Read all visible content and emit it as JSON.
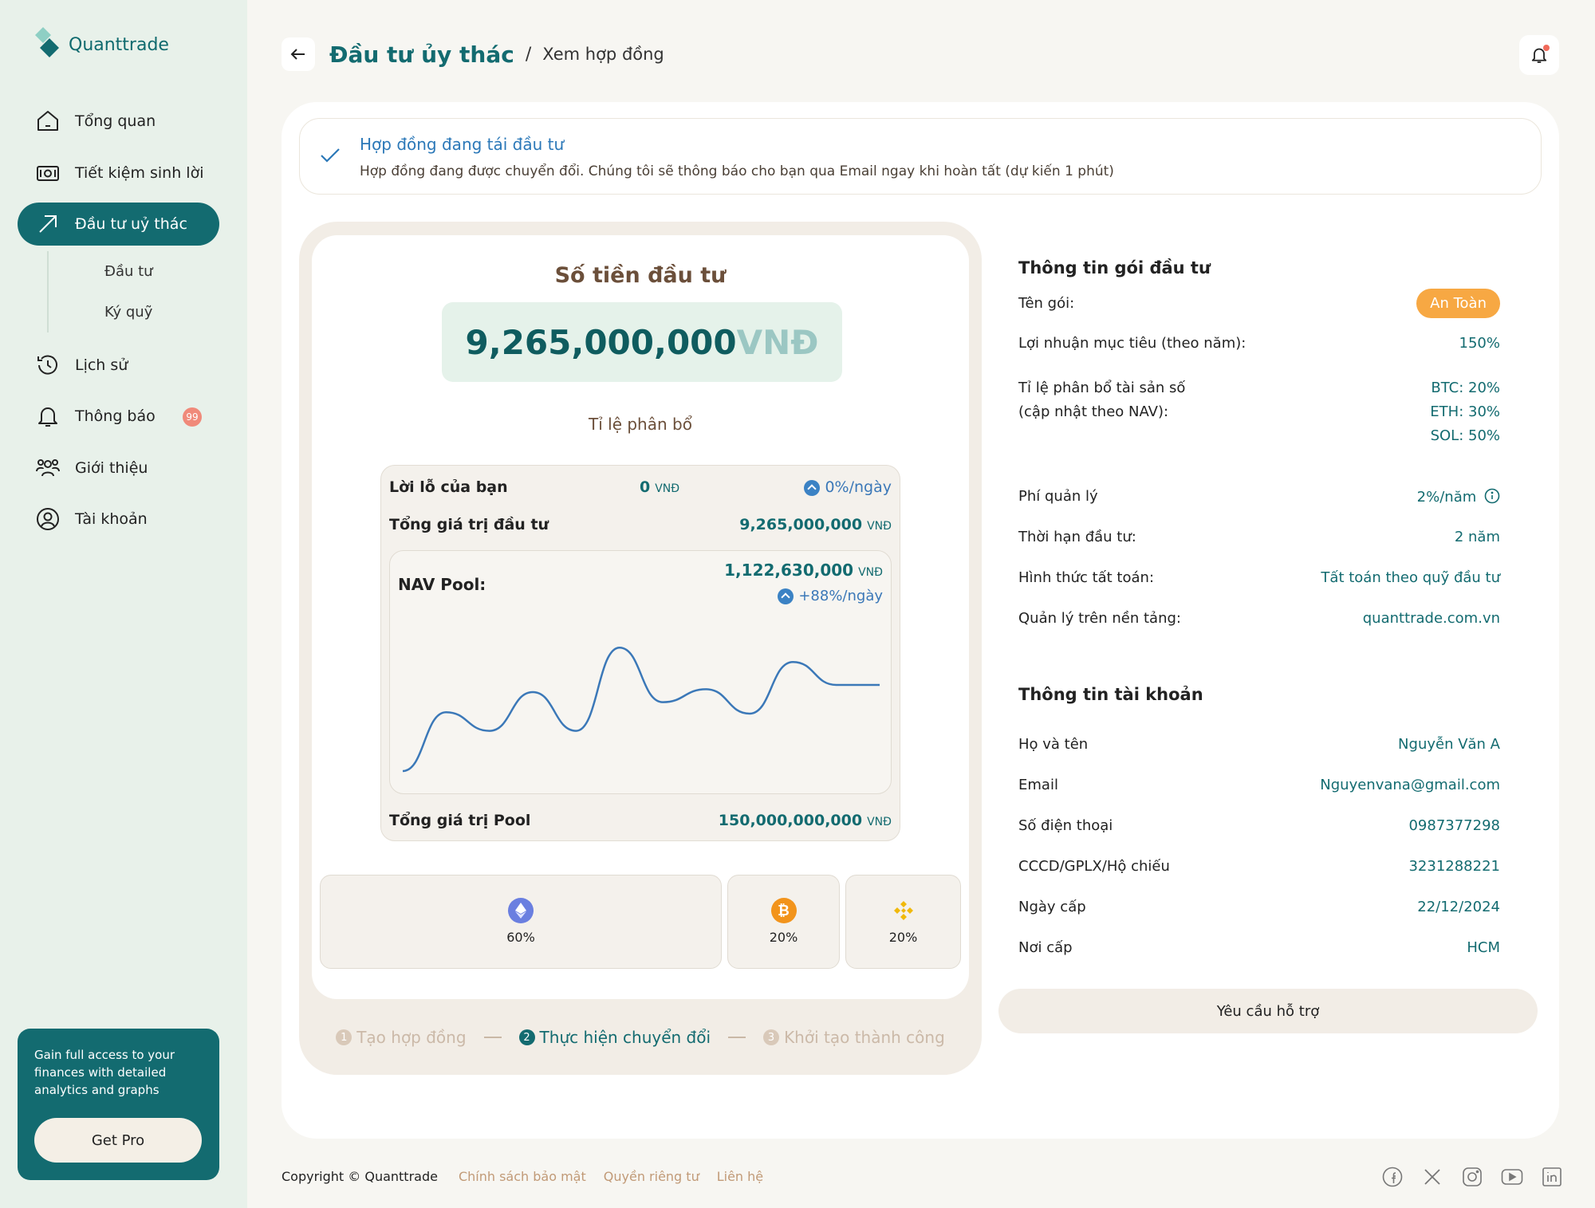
{
  "app": {
    "name": "Quanttrade"
  },
  "sidebar": {
    "items": [
      {
        "label": "Tổng quan"
      },
      {
        "label": "Tiết kiệm sinh lời"
      },
      {
        "label": "Đầu tư uỷ thác"
      },
      {
        "label": "Lịch sử"
      },
      {
        "label": "Thông báo",
        "badge": "99"
      },
      {
        "label": "Giới thiệu"
      },
      {
        "label": "Tài khoản"
      }
    ],
    "subitems": [
      {
        "label": "Đầu tư"
      },
      {
        "label": "Ký quỹ"
      }
    ],
    "promo": {
      "text": "Gain full access to your finances with detailed analytics and graphs",
      "button": "Get Pro"
    }
  },
  "header": {
    "title": "Đầu tư ủy thác",
    "separator": "/",
    "breadcrumb": "Xem hợp đồng"
  },
  "alert": {
    "title": "Hợp đồng đang tái đầu tư",
    "message": "Hợp đồng đang được chuyển đổi. Chúng tôi sẽ thông báo cho bạn qua Email ngay khi hoàn tất (dự kiến 1 phút)"
  },
  "investment": {
    "title": "Số tiền đầu tư",
    "amount": "9,265,000,000",
    "unit": "VNĐ",
    "allocation_label": "Tỉ lệ phân bổ",
    "pnl_label": "Lời lỗ của bạn",
    "pnl_value": "0",
    "pnl_unit": "VNĐ",
    "pnl_rate": "0%/ngày",
    "total_label": "Tổng giá trị đầu tư",
    "total_value": "9,265,000,000",
    "total_unit": "VNĐ",
    "nav_label": "NAV Pool:",
    "nav_value": "1,122,630,000",
    "nav_unit": "VNĐ",
    "nav_rate": "+88%/ngày",
    "pool_label": "Tổng giá trị Pool",
    "pool_value": "150,000,000,000",
    "pool_unit": "VNĐ",
    "coins": [
      {
        "icon": "ethereum-icon",
        "pct": "60%",
        "color": "#6a7fe0"
      },
      {
        "icon": "bitcoin-icon",
        "pct": "20%",
        "color": "#f2941c"
      },
      {
        "icon": "binance-icon",
        "pct": "20%",
        "color": "#f0b90b"
      }
    ]
  },
  "chart_data": {
    "type": "line",
    "series": [
      {
        "values": [
          5,
          46,
          33,
          60,
          33,
          91,
          53,
          62,
          45,
          81,
          65,
          65
        ]
      }
    ],
    "ylim": [
      0,
      100
    ],
    "color": "#3b78b8"
  },
  "stepper": [
    {
      "num": "1",
      "label": "Tạo hợp đồng"
    },
    {
      "num": "2",
      "label": "Thực hiện chuyển đổi"
    },
    {
      "num": "3",
      "label": "Khởi tạo thành công"
    }
  ],
  "package": {
    "title": "Thông tin gói đầu tư",
    "name_label": "Tên gói:",
    "name_value": "An Toàn",
    "profit_label": "Lợi nhuận mục tiêu (theo năm):",
    "profit_value": "150%",
    "alloc_label_1": "Tỉ lệ phân bổ tài sản số",
    "alloc_label_2": "(cập nhật theo NAV):",
    "alloc_btc": "BTC: 20%",
    "alloc_eth": "ETH: 30%",
    "alloc_sol": "SOL: 50%",
    "fee_label": "Phí quản lý",
    "fee_value": "2%/năm",
    "term_label": "Thời hạn đầu tư:",
    "term_value": "2 năm",
    "settle_label": "Hình thức tất toán:",
    "settle_value": "Tất toán theo quỹ đầu tư",
    "platform_label": "Quản lý trên nền tảng:",
    "platform_value": "quanttrade.com.vn"
  },
  "account": {
    "title": "Thông tin tài khoản",
    "name_label": "Họ và tên",
    "name_value": "Nguyễn Văn A",
    "email_label": "Email",
    "email_value": "Nguyenvana@gmail.com",
    "phone_label": "Số điện thoại",
    "phone_value": "0987377298",
    "id_label": "CCCD/GPLX/Hộ chiếu",
    "id_value": "3231288221",
    "issue_date_label": "Ngày cấp",
    "issue_date_value": "22/12/2024",
    "issue_place_label": "Nơi cấp",
    "issue_place_value": "HCM"
  },
  "support_button": "Yêu cầu hỗ trợ",
  "footer": {
    "copyright": "Copyright © Quanttrade",
    "links": [
      "Chính sách bảo mật",
      "Quyền riêng tư",
      "Liên hệ"
    ]
  }
}
